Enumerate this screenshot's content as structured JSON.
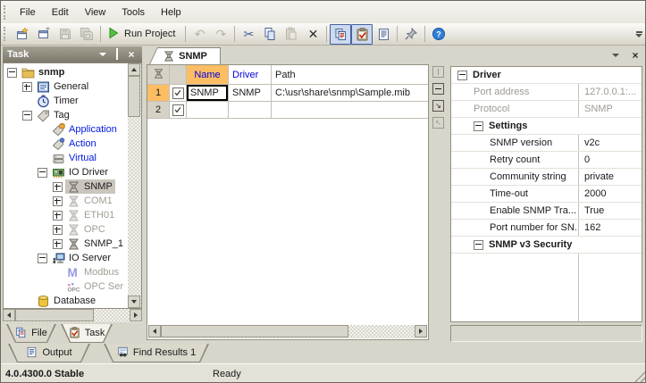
{
  "menu": {
    "items": [
      {
        "label": "File"
      },
      {
        "label": "Edit"
      },
      {
        "label": "View"
      },
      {
        "label": "Tools"
      },
      {
        "label": "Help"
      }
    ]
  },
  "toolbar": {
    "run_label": "Run Project"
  },
  "task_panel": {
    "title": "Task",
    "tree": {
      "items": [
        {
          "label": "snmp"
        },
        {
          "label": "General"
        },
        {
          "label": "Timer"
        },
        {
          "label": "Tag"
        },
        {
          "label": "Application"
        },
        {
          "label": "Action"
        },
        {
          "label": "Virtual"
        },
        {
          "label": "IO Driver"
        },
        {
          "label": "SNMP"
        },
        {
          "label": "COM1"
        },
        {
          "label": "ETH01"
        },
        {
          "label": "OPC"
        },
        {
          "label": "SNMP_1"
        },
        {
          "label": "IO Server"
        },
        {
          "label": "Modbus"
        },
        {
          "label": "OPC Ser"
        },
        {
          "label": "Database"
        }
      ]
    },
    "tabs": [
      {
        "label": "File"
      },
      {
        "label": "Task"
      }
    ]
  },
  "document": {
    "tab_label": "SNMP",
    "grid": {
      "columns": [
        "Name",
        "Driver",
        "Path"
      ],
      "rows": [
        {
          "num": "1",
          "name": "SNMP",
          "driver": "SNMP",
          "path": "C:\\usr\\share\\snmp\\Sample.mib"
        },
        {
          "num": "2",
          "name": "",
          "driver": "",
          "path": ""
        }
      ]
    }
  },
  "properties": {
    "rows": [
      {
        "label": "Driver",
        "value": ""
      },
      {
        "label": "Port address",
        "value": "127.0.0.1:..."
      },
      {
        "label": "Protocol",
        "value": "SNMP"
      },
      {
        "label": "Settings",
        "value": ""
      },
      {
        "label": "SNMP version",
        "value": "v2c"
      },
      {
        "label": "Retry count",
        "value": "0"
      },
      {
        "label": "Community string",
        "value": "private"
      },
      {
        "label": "Time-out",
        "value": "2000"
      },
      {
        "label": "Enable SNMP Tra...",
        "value": "True"
      },
      {
        "label": "Port number for SN...",
        "value": "162"
      },
      {
        "label": "SNMP v3 Security",
        "value": ""
      }
    ]
  },
  "bottom_tabs": [
    {
      "label": "Output"
    },
    {
      "label": "Find Results 1"
    }
  ],
  "status_bar": {
    "version": "4.0.4300.0 Stable",
    "state": "Ready"
  },
  "colors": {
    "current_row_orange": "#fdbd63",
    "header_text_blue": "#0000dd",
    "tree_link_blue": "#0019e0",
    "panel_header_grey": "#83816f",
    "selection_grey": "#cac6bd"
  }
}
